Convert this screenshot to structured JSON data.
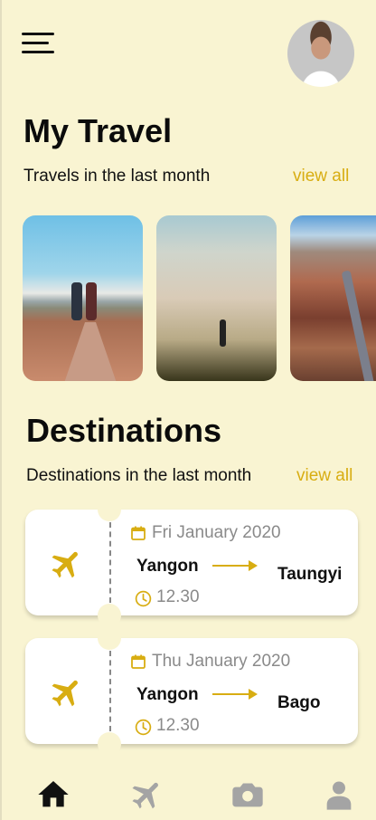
{
  "header": {
    "menu_icon": "hamburger-menu-icon",
    "avatar_icon": "user-avatar"
  },
  "travel": {
    "title": "My Travel",
    "subtitle": "Travels in the last month",
    "view_all": "view all",
    "photos": [
      "mountain-trail-photo",
      "desert-dunes-photo",
      "canyon-road-photo"
    ]
  },
  "destinations": {
    "title": "Destinations",
    "subtitle": "Destinations in the last month",
    "view_all": "view all",
    "tickets": [
      {
        "date": "Fri January 2020",
        "from": "Yangon",
        "to": "Taungyi",
        "time": "12.30"
      },
      {
        "date": "Thu January 2020",
        "from": "Yangon",
        "to": "Bago",
        "time": "12.30"
      }
    ]
  },
  "bottom_nav": {
    "items": [
      "home-icon",
      "plane-icon",
      "camera-icon",
      "profile-icon"
    ],
    "active": "home-icon"
  },
  "colors": {
    "background": "#f9f4d2",
    "accent": "#d8ad12",
    "text": "#111111",
    "inactive": "#a4a4a4"
  }
}
